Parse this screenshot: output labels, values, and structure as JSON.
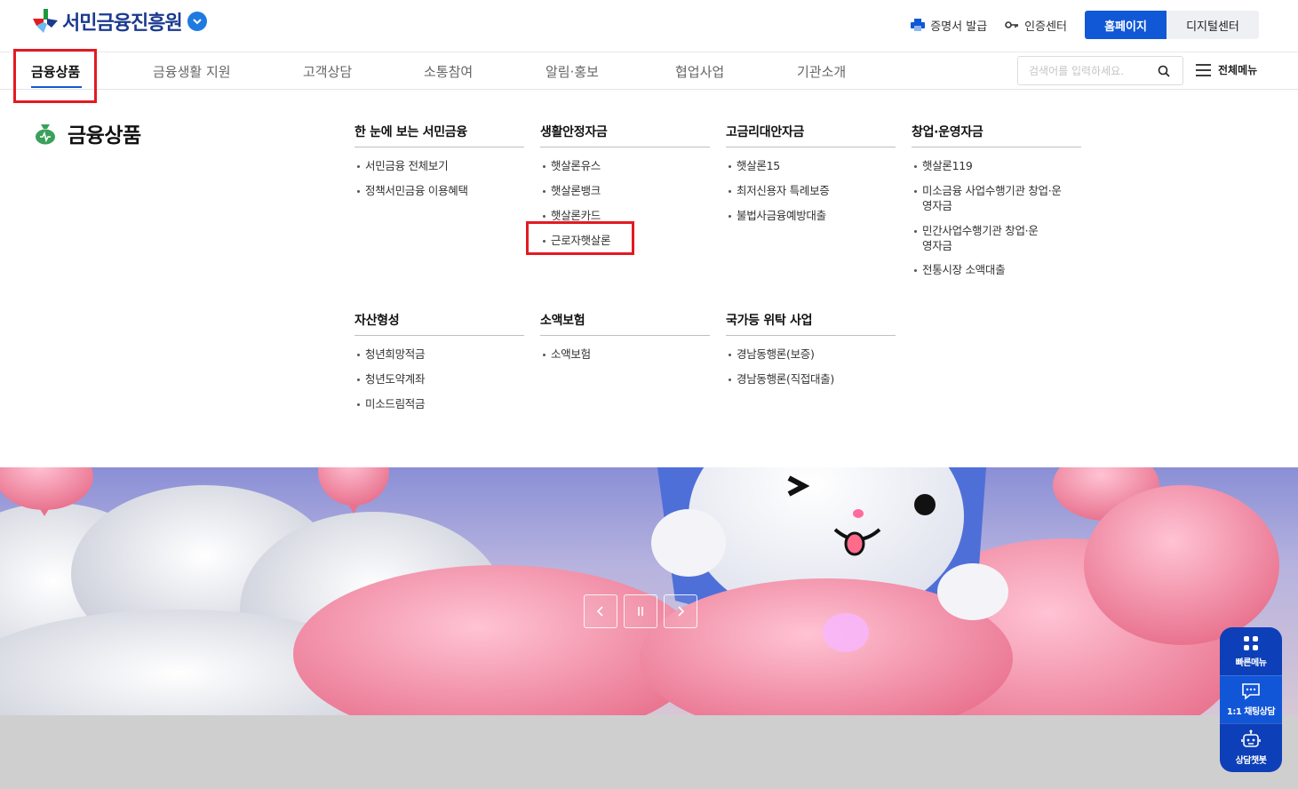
{
  "header": {
    "logo_text": "서민금융진흥원",
    "util_links": [
      {
        "label": "증명서 발급",
        "icon": "printer-icon"
      },
      {
        "label": "인증센터",
        "icon": "key-icon"
      }
    ],
    "home_button": "홈페이지",
    "digital_button": "디지털센터"
  },
  "gnb": {
    "items": [
      "금융상품",
      "금융생활 지원",
      "고객상담",
      "소통참여",
      "알림·홍보",
      "협업사업",
      "기관소개"
    ],
    "active": "금융상품",
    "search_placeholder": "검색어를 입력하세요.",
    "all_menu_label": "전체메뉴"
  },
  "mega": {
    "title": "금융상품",
    "title_icon": "money-bag-icon",
    "columns": [
      {
        "heading": "한 눈에 보는 서민금융",
        "items": [
          "서민금융 전체보기",
          "정책서민금융 이용혜택"
        ]
      },
      {
        "heading": "생활안정자금",
        "items": [
          "햇살론유스",
          "햇살론뱅크",
          "햇살론카드",
          "근로자햇살론"
        ]
      },
      {
        "heading": "고금리대안자금",
        "items": [
          "햇살론15",
          "최저신용자 특례보증",
          "불법사금융예방대출"
        ]
      },
      {
        "heading": "창업·운영자금",
        "items": [
          "햇살론119",
          "미소금융 사업수행기관 창업·운영자금",
          "민간사업수행기관 창업·운영자금",
          "전통시장 소액대출"
        ]
      },
      {
        "heading": "자산형성",
        "items": [
          "청년희망적금",
          "청년도약계좌",
          "미소드림적금"
        ]
      },
      {
        "heading": "소액보험",
        "items": [
          "소액보험"
        ]
      },
      {
        "heading": "국가등 위탁 사업",
        "items": [
          "경남동행론(보증)",
          "경남동행론(직접대출)"
        ]
      }
    ]
  },
  "quick_menu": [
    {
      "label": "빠른메뉴",
      "icon": "grid-icon"
    },
    {
      "label": "1:1 채팅상담",
      "icon": "chat-icon"
    },
    {
      "label": "상담챗봇",
      "icon": "robot-icon"
    }
  ],
  "colors": {
    "brand": "#1158d6",
    "highlight": "#e21a22",
    "quick_bg": "#0d3fb8"
  }
}
